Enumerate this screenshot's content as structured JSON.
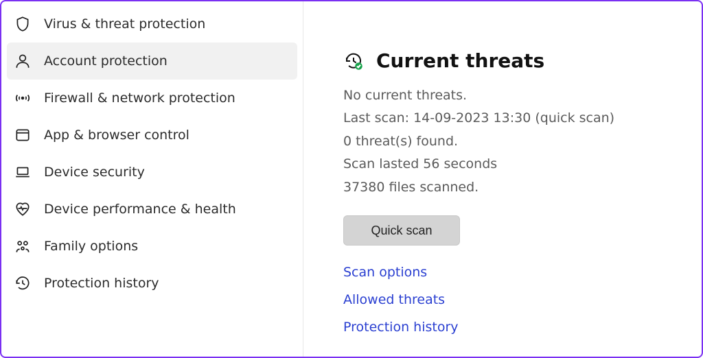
{
  "sidebar": {
    "items": [
      {
        "id": "virus",
        "label": "Virus & threat protection",
        "icon": "shield-icon"
      },
      {
        "id": "account",
        "label": "Account protection",
        "icon": "account-icon",
        "selected": true
      },
      {
        "id": "firewall",
        "label": "Firewall & network protection",
        "icon": "antenna-icon"
      },
      {
        "id": "app",
        "label": "App & browser control",
        "icon": "window-icon"
      },
      {
        "id": "device",
        "label": "Device security",
        "icon": "laptop-icon"
      },
      {
        "id": "perf",
        "label": "Device performance & health",
        "icon": "heart-pulse-icon"
      },
      {
        "id": "family",
        "label": "Family options",
        "icon": "family-icon"
      },
      {
        "id": "history",
        "label": "Protection history",
        "icon": "history-icon"
      }
    ]
  },
  "main": {
    "section_title": "Current threats",
    "section_icon": "history-check-icon",
    "status": {
      "no_threats": "No current threats.",
      "last_scan": "Last scan: 14-09-2023 13:30 (quick scan)",
      "threats_found": "0 threat(s) found.",
      "scan_duration": "Scan lasted 56 seconds",
      "files_scanned": "37380 files scanned."
    },
    "quick_scan_label": "Quick scan",
    "links": {
      "scan_options": "Scan options",
      "allowed_threats": "Allowed threats",
      "protection_history": "Protection history"
    }
  },
  "annotation": {
    "arrow_color": "#7a2ff2"
  }
}
